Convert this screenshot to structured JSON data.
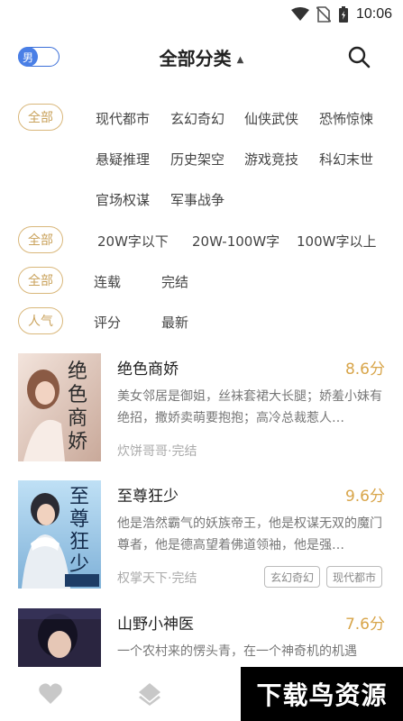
{
  "status_bar": {
    "time": "10:06",
    "icons": [
      "wifi-icon",
      "no-sim-icon",
      "battery-charging-icon"
    ]
  },
  "header": {
    "gender_label": "男",
    "title": "全部分类",
    "caret": "▲",
    "search_icon": "search-icon"
  },
  "filters": {
    "category": {
      "all": "全部",
      "options": [
        "现代都市",
        "玄幻奇幻",
        "仙侠武侠",
        "恐怖惊悚",
        "悬疑推理",
        "历史架空",
        "游戏竞技",
        "科幻末世",
        "官场权谋",
        "军事战争"
      ]
    },
    "word_count": {
      "all": "全部",
      "options": [
        "20W字以下",
        "20W-100W字",
        "100W字以上"
      ]
    },
    "status": {
      "all": "全部",
      "options": [
        "连载",
        "完结"
      ]
    },
    "sort": {
      "active": "人气",
      "options": [
        "评分",
        "最新"
      ]
    }
  },
  "books": [
    {
      "title": "绝色商娇",
      "score": "8.6分",
      "desc": "美女邻居是御姐，丝袜套裙大长腿；娇羞小妹有绝招，撒娇卖萌要抱抱；高冷总裁惹人…",
      "meta": "炊饼哥哥·完结",
      "tags": [],
      "cover_text": [
        "绝",
        "色",
        "商",
        "娇"
      ]
    },
    {
      "title": "至尊狂少",
      "score": "9.6分",
      "desc": "他是浩然霸气的妖族帝王，他是权谋无双的魔门尊者，他是德高望着佛道领袖，他是强…",
      "meta": "权掌天下·完结",
      "tags": [
        "玄幻奇幻",
        "现代都市"
      ],
      "cover_text": [
        "至",
        "尊",
        "狂",
        "少"
      ]
    },
    {
      "title": "山野小神医",
      "score": "7.6分",
      "desc": "一个农村来的愣头青，在一个神奇机的机遇",
      "meta": "",
      "tags": [],
      "cover_text": []
    }
  ],
  "bottom_nav": {
    "icons": [
      "heart-icon",
      "layers-icon"
    ]
  },
  "watermark": "下载鸟资源",
  "colors": {
    "accent_gold": "#d8a54a",
    "toggle_blue": "#4a7fe6"
  }
}
